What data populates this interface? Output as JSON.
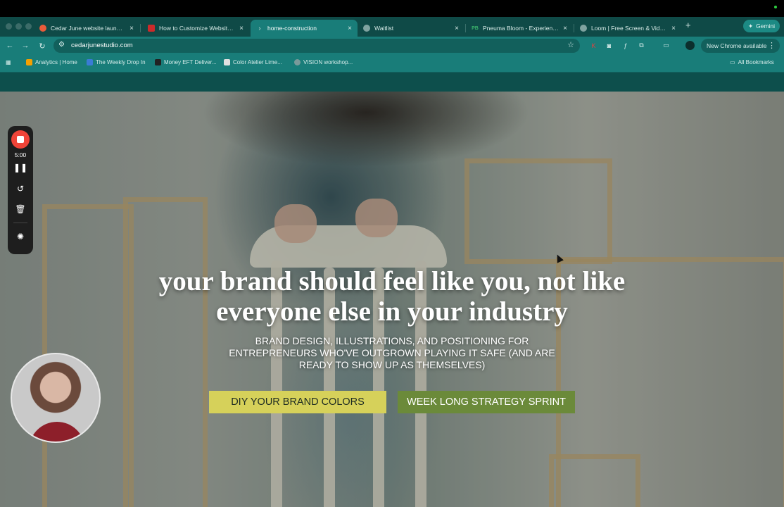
{
  "browser": {
    "tabs": [
      {
        "title": "Cedar June website launch st",
        "favicon_color": "#e85b3a",
        "active": false
      },
      {
        "title": "How to Customize Website Te",
        "favicon_color": "#cc2a2a",
        "active": false
      },
      {
        "title": "home-construction",
        "favicon_color": "#ffffff",
        "active": true
      },
      {
        "title": "Waitlist",
        "favicon_color": "#9ab",
        "active": false
      },
      {
        "title": "Pneuma Bloom - Experience",
        "favicon_color": "#3ab06a",
        "favicon_text": "PB",
        "active": false
      },
      {
        "title": "Loom | Free Screen & Video R",
        "favicon_color": "#9ab",
        "active": false
      }
    ],
    "new_tab_icon": "plus-icon",
    "gemini_label": "Gemini",
    "url": "cedarjunestudio.com",
    "update_label": "New Chrome available",
    "bookmarks": [
      {
        "label": "Analytics | Home",
        "color": "#f4a000"
      },
      {
        "label": "The Weekly Drop In",
        "color": "#3a7bd5"
      },
      {
        "label": "Money EFT Deliver...",
        "color": "#222222"
      },
      {
        "label": "Color Atelier Lime...",
        "color": "#e0e0e0"
      },
      {
        "label": "VISION workshop...",
        "color": "#7a9a9a"
      }
    ],
    "all_bookmarks_label": "All Bookmarks"
  },
  "hero": {
    "headline": "your brand should feel like you, not like everyone else in your industry",
    "subline": "BRAND DESIGN, ILLUSTRATIONS, AND POSITIONING FOR ENTREPRENEURS WHO'VE OUTGROWN PLAYING IT SAFE (AND ARE READY TO SHOW UP AS THEMSELVES)",
    "cta_primary": "DIY YOUR BRAND COLORS",
    "cta_secondary": "WEEK LONG STRATEGY SPRINT",
    "cta_primary_color": "#d6d15a",
    "cta_secondary_color": "#6b8a3a"
  },
  "recorder": {
    "time": "5:00",
    "stop_color": "#f04438"
  },
  "colors": {
    "tabstrip": "#0f4a47",
    "toolbar": "#197d79",
    "site_header": "#0d4f4c"
  }
}
